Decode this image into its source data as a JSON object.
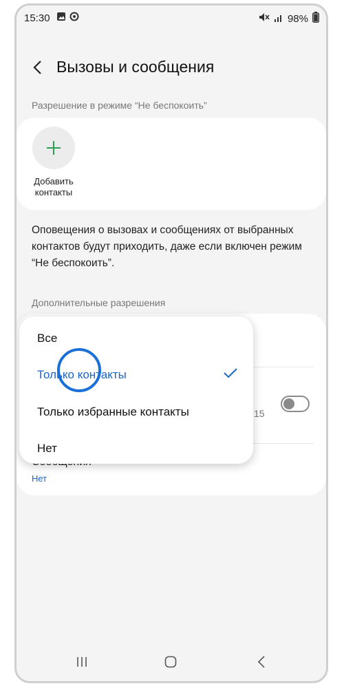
{
  "status": {
    "time": "15:30",
    "battery": "98%"
  },
  "header": {
    "title": "Вызовы и сообщения"
  },
  "dnd_section": {
    "label": "Разрешение в режиме “Не беспокоить”",
    "add_label": "Добавить контакты"
  },
  "description": "Оповещения о вызовах и сообщениях от выбранных контактов будут приходить, даже если включен режим “Не беспокоить”.",
  "extra_section": {
    "label": "Дополнительные разрешения",
    "partial_value": "15",
    "messages_label": "Сообщения",
    "messages_value": "Нет"
  },
  "popup": {
    "options": [
      "Все",
      "Только контакты",
      "Только избранные контакты",
      "Нет"
    ],
    "selected_index": 1
  },
  "colors": {
    "accent": "#1a66c9",
    "add_plus": "#2aa052",
    "background": "#f4f4f4",
    "card": "#ffffff"
  },
  "icons": [
    "image-icon",
    "sync-icon",
    "mute-icon",
    "signal-icon",
    "battery-icon",
    "back-icon",
    "plus-icon",
    "check-icon",
    "recents-icon",
    "home-icon",
    "nav-back-icon"
  ]
}
